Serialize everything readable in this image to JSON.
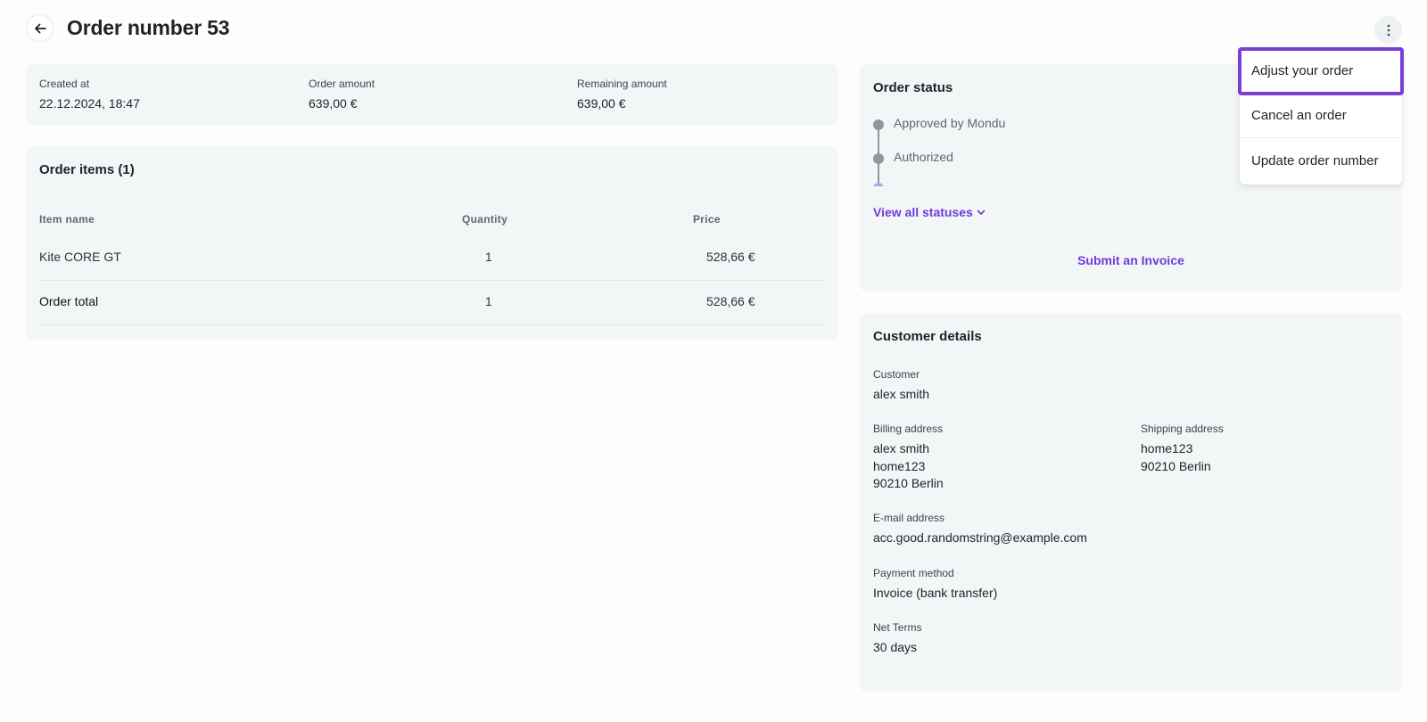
{
  "header": {
    "title": "Order number 53"
  },
  "summary": {
    "created_at_label": "Created at",
    "created_at_value": "22.12.2024, 18:47",
    "order_amount_label": "Order amount",
    "order_amount_value": "639,00 €",
    "remaining_amount_label": "Remaining amount",
    "remaining_amount_value": "639,00 €"
  },
  "order_items": {
    "title": "Order items (1)",
    "columns": [
      "Item name",
      "Quantity",
      "Price"
    ],
    "rows": [
      {
        "name": "Kite CORE GT",
        "quantity": "1",
        "price": "528,66 €"
      }
    ],
    "total": {
      "name": "Order total",
      "quantity": "1",
      "price": "528,66 €"
    }
  },
  "order_status": {
    "title": "Order status",
    "statuses": [
      "Approved by Mondu",
      "Authorized"
    ],
    "view_all_label": "View all statuses",
    "submit_invoice_label": "Submit an Invoice"
  },
  "customer_details": {
    "title": "Customer details",
    "customer_label": "Customer",
    "customer_value": "alex smith",
    "billing_label": "Billing address",
    "billing_lines": [
      "alex smith",
      "home123",
      "90210 Berlin"
    ],
    "shipping_label": "Shipping address",
    "shipping_lines": [
      "home123",
      "90210 Berlin"
    ],
    "email_label": "E-mail address",
    "email_value": "acc.good.randomstring@example.com",
    "payment_label": "Payment method",
    "payment_value": "Invoice (bank transfer)",
    "net_terms_label": "Net Terms",
    "net_terms_value": "30 days"
  },
  "menu": {
    "items": [
      "Adjust your order",
      "Cancel an order",
      "Update order number"
    ]
  },
  "colors": {
    "accent": "#6f3bd8",
    "highlight": "#7a3fd6",
    "card_bg": "#f3f6f7"
  },
  "icons": {
    "back": "arrow-left-icon",
    "more": "more-vertical-icon",
    "expand": "chevron-down-icon"
  }
}
